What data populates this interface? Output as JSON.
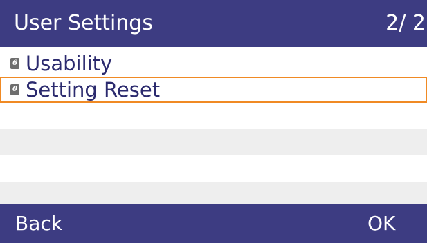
{
  "header": {
    "title": "User Settings",
    "page_indicator": "2/ 2"
  },
  "menu": {
    "items": [
      {
        "key": "6",
        "label": "Usability",
        "selected": false
      },
      {
        "key": "0",
        "label": "Setting Reset",
        "selected": true
      }
    ]
  },
  "softkeys": {
    "left_label": "Back",
    "right_label": "OK"
  },
  "colors": {
    "bar_background": "#3d3c82",
    "text": "#2b2a6e",
    "selection_border": "#f08a24",
    "stripe": "#eeeeee"
  }
}
